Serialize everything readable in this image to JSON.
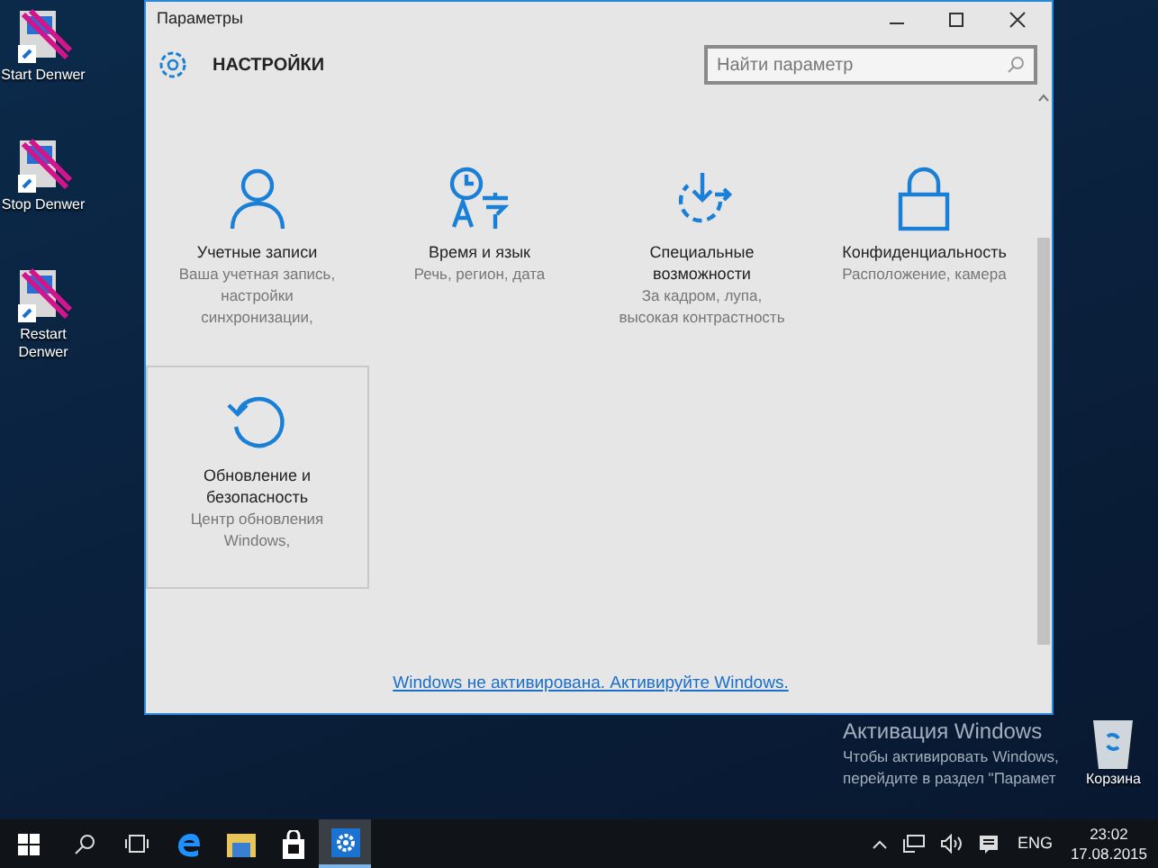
{
  "desktop_icons": [
    {
      "label": "Start Denwer"
    },
    {
      "label": "Stop Denwer"
    },
    {
      "label": "Restart Denwer"
    }
  ],
  "window": {
    "title": "Параметры",
    "heading": "НАСТРОЙКИ",
    "search": {
      "placeholder": "Найти параметр"
    },
    "tiles": [
      {
        "kind": "person",
        "title": "Учетные записи",
        "description": "Ваша учетная запись, настройки синхронизации,",
        "selected": false
      },
      {
        "kind": "time",
        "title": "Время и язык",
        "description": "Речь, регион, дата",
        "selected": false
      },
      {
        "kind": "access",
        "title": "Специальные возможности",
        "description": "За кадром, лупа, высокая контрастность",
        "selected": false
      },
      {
        "kind": "lock",
        "title": "Конфиденциальность",
        "description": "Расположение, камера",
        "selected": false
      },
      {
        "kind": "update",
        "title": "Обновление и безопасность",
        "description": "Центр обновления Windows,",
        "selected": true
      }
    ],
    "activation_link": "Windows не активирована. Активируйте Windows."
  },
  "activation_notice": {
    "title": "Активация Windows",
    "line_1": "Чтобы активировать Windows,",
    "line_2": "перейдите в раздел \"Парамет"
  },
  "recycle_bin": {
    "label": "Корзина"
  },
  "taskbar": {
    "apps": [
      {
        "kind": "edge",
        "selected": false
      },
      {
        "kind": "explorer",
        "selected": false
      },
      {
        "kind": "store",
        "selected": false
      },
      {
        "kind": "settings",
        "selected": true
      }
    ],
    "language": "ENG",
    "time": "23:02",
    "date": "17.08.2015"
  }
}
